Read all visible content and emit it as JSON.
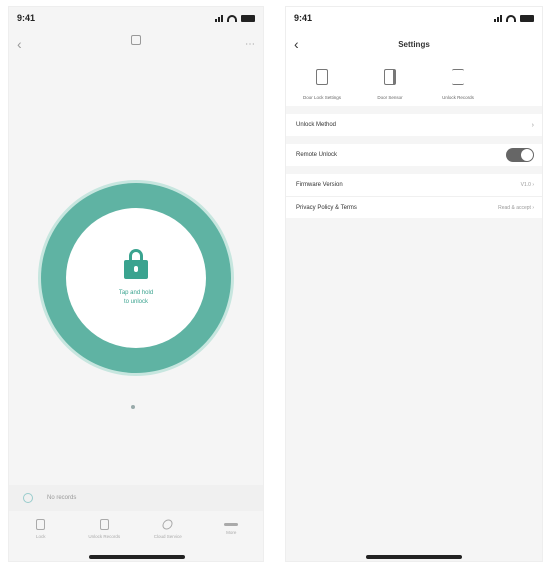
{
  "left": {
    "status": {
      "time": "9:41"
    },
    "nav": {
      "back_icon": "chevron-left-icon",
      "more_icon": "more-icon",
      "device_name": ""
    },
    "main": {
      "lock_icon": "lock-icon",
      "prompt_line1": "Tap and hold",
      "prompt_line2": "to unlock"
    },
    "recent": {
      "text": "No records"
    },
    "tabs": [
      {
        "label": "Lock",
        "icon": "lock-icon"
      },
      {
        "label": "Unlock Records",
        "icon": "list-icon"
      },
      {
        "label": "Cloud Service",
        "icon": "cloud-icon"
      },
      {
        "label": "More",
        "icon": "more-icon"
      }
    ]
  },
  "right": {
    "status": {
      "time": "9:41"
    },
    "nav": {
      "back_icon": "chevron-left-icon",
      "title": "Settings"
    },
    "quick_actions": [
      {
        "label": "Door Lock Settings",
        "icon": "lock-icon"
      },
      {
        "label": "Door Sensor",
        "icon": "door-icon"
      },
      {
        "label": "Unlock Records",
        "icon": "list-icon"
      }
    ],
    "rows": [
      {
        "label": "Unlock Method",
        "kind": "link"
      },
      {
        "label": "Remote Unlock",
        "kind": "toggle",
        "state": "on"
      },
      {
        "label": "Firmware Version",
        "value": "V1.0",
        "kind": "link"
      },
      {
        "label": "Privacy Policy & Terms",
        "value": "Read & accept",
        "kind": "link"
      }
    ]
  }
}
